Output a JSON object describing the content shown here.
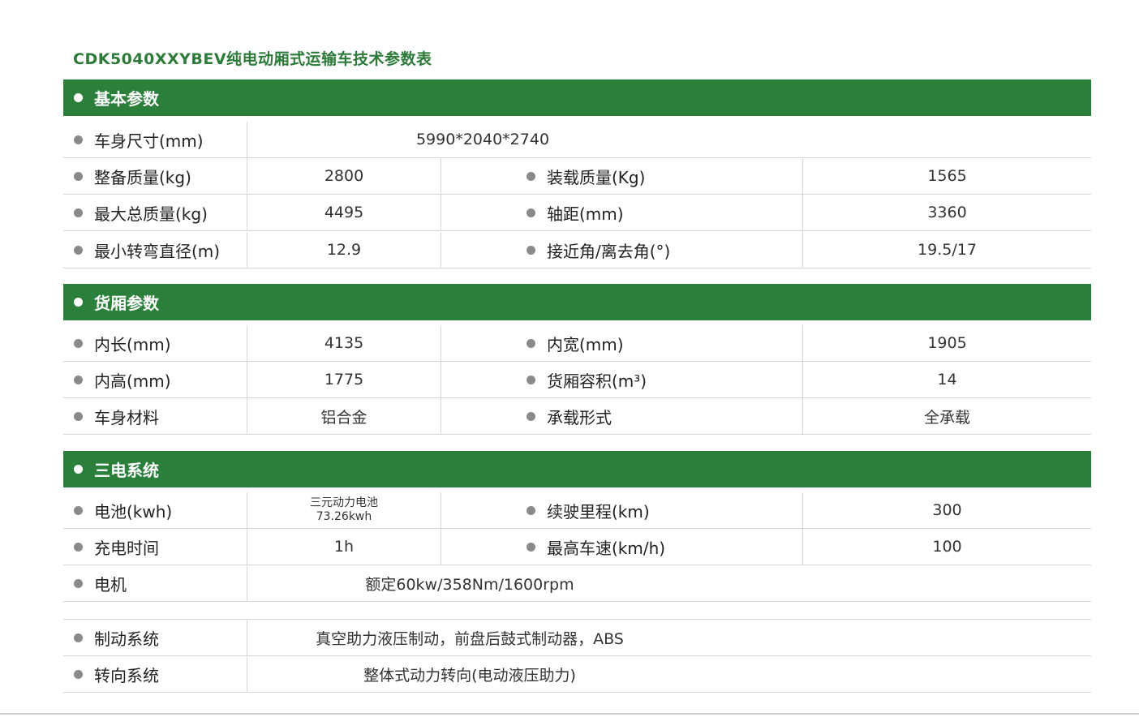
{
  "title": "CDK5040XXYBEV纯电动厢式运输车技术参数表",
  "sections": {
    "basic": {
      "header": "基本参数",
      "rows": [
        {
          "label": "车身尺寸(mm)",
          "value": "5990*2040*2740"
        },
        {
          "label": "整备质量(kg)",
          "value": "2800",
          "label2": "装载质量(Kg)",
          "value2": "1565"
        },
        {
          "label": "最大总质量(kg)",
          "value": "4495",
          "label2": "轴距(mm)",
          "value2": "3360"
        },
        {
          "label": "最小转弯直径(m)",
          "value": "12.9",
          "label2": "接近角/离去角(°)",
          "value2": "19.5/17"
        }
      ]
    },
    "cargo": {
      "header": "货厢参数",
      "rows": [
        {
          "label": "内长(mm)",
          "value": "4135",
          "label2": "内宽(mm)",
          "value2": "1905"
        },
        {
          "label": "内高(mm)",
          "value": "1775",
          "label2": "货厢容积(m³)",
          "value2": "14"
        },
        {
          "label": "车身材料",
          "value": "铝合金",
          "label2": "承载形式",
          "value2": "全承载"
        }
      ]
    },
    "electric": {
      "header": "三电系统",
      "rows": [
        {
          "label": "电池(kwh)",
          "value_line1": "三元动力电池",
          "value_line2": "73.26kwh",
          "label2": "续驶里程(km)",
          "value2": "300"
        },
        {
          "label": "充电时间",
          "value": "1h",
          "label2": "最高车速(km/h)",
          "value2": "100"
        },
        {
          "label": "电机",
          "value": "额定60kw/358Nm/1600rpm"
        }
      ]
    },
    "chassis": {
      "rows": [
        {
          "label": "制动系统",
          "value": "真空助力液压制动，前盘后鼓式制动器，ABS"
        },
        {
          "label": "转向系统",
          "value": "整体式动力转向(电动液压助力)"
        }
      ]
    }
  }
}
